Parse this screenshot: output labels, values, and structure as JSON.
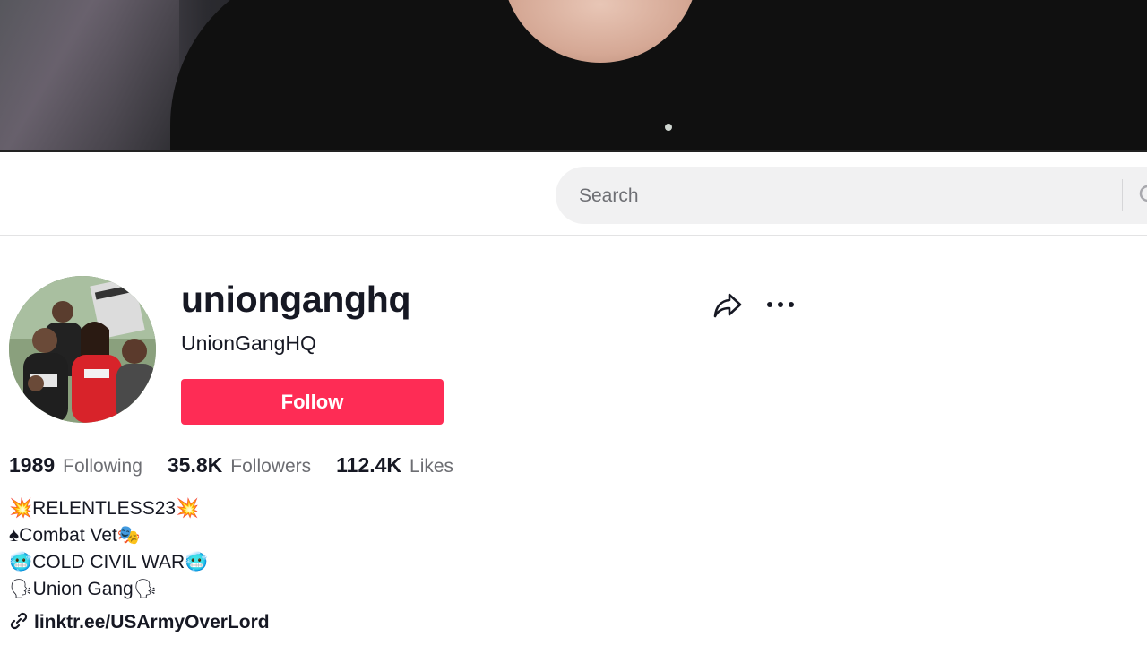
{
  "header": {
    "search": {
      "placeholder": "Search"
    }
  },
  "profile": {
    "username": "unionganghq",
    "nickname": "UnionGangHQ",
    "follow_label": "Follow",
    "stats": [
      {
        "value": "1989",
        "label": "Following"
      },
      {
        "value": "35.8K",
        "label": "Followers"
      },
      {
        "value": "112.4K",
        "label": "Likes"
      }
    ],
    "bio_lines": [
      "💥RELENTLESS23💥",
      "♠Combat Vet🎭",
      "🥶COLD CIVIL WAR🥶",
      "🗣Union Gang🗣"
    ],
    "link": "linktr.ee/USArmyOverLord"
  },
  "colors": {
    "accent": "#fe2c55",
    "text_primary": "#161823",
    "text_secondary": "#6d6e73",
    "search_bg": "#f1f1f2"
  },
  "icons": {
    "share": "share-arrow-icon",
    "more": "more-dots-icon",
    "search": "search-icon",
    "link": "link-icon"
  }
}
